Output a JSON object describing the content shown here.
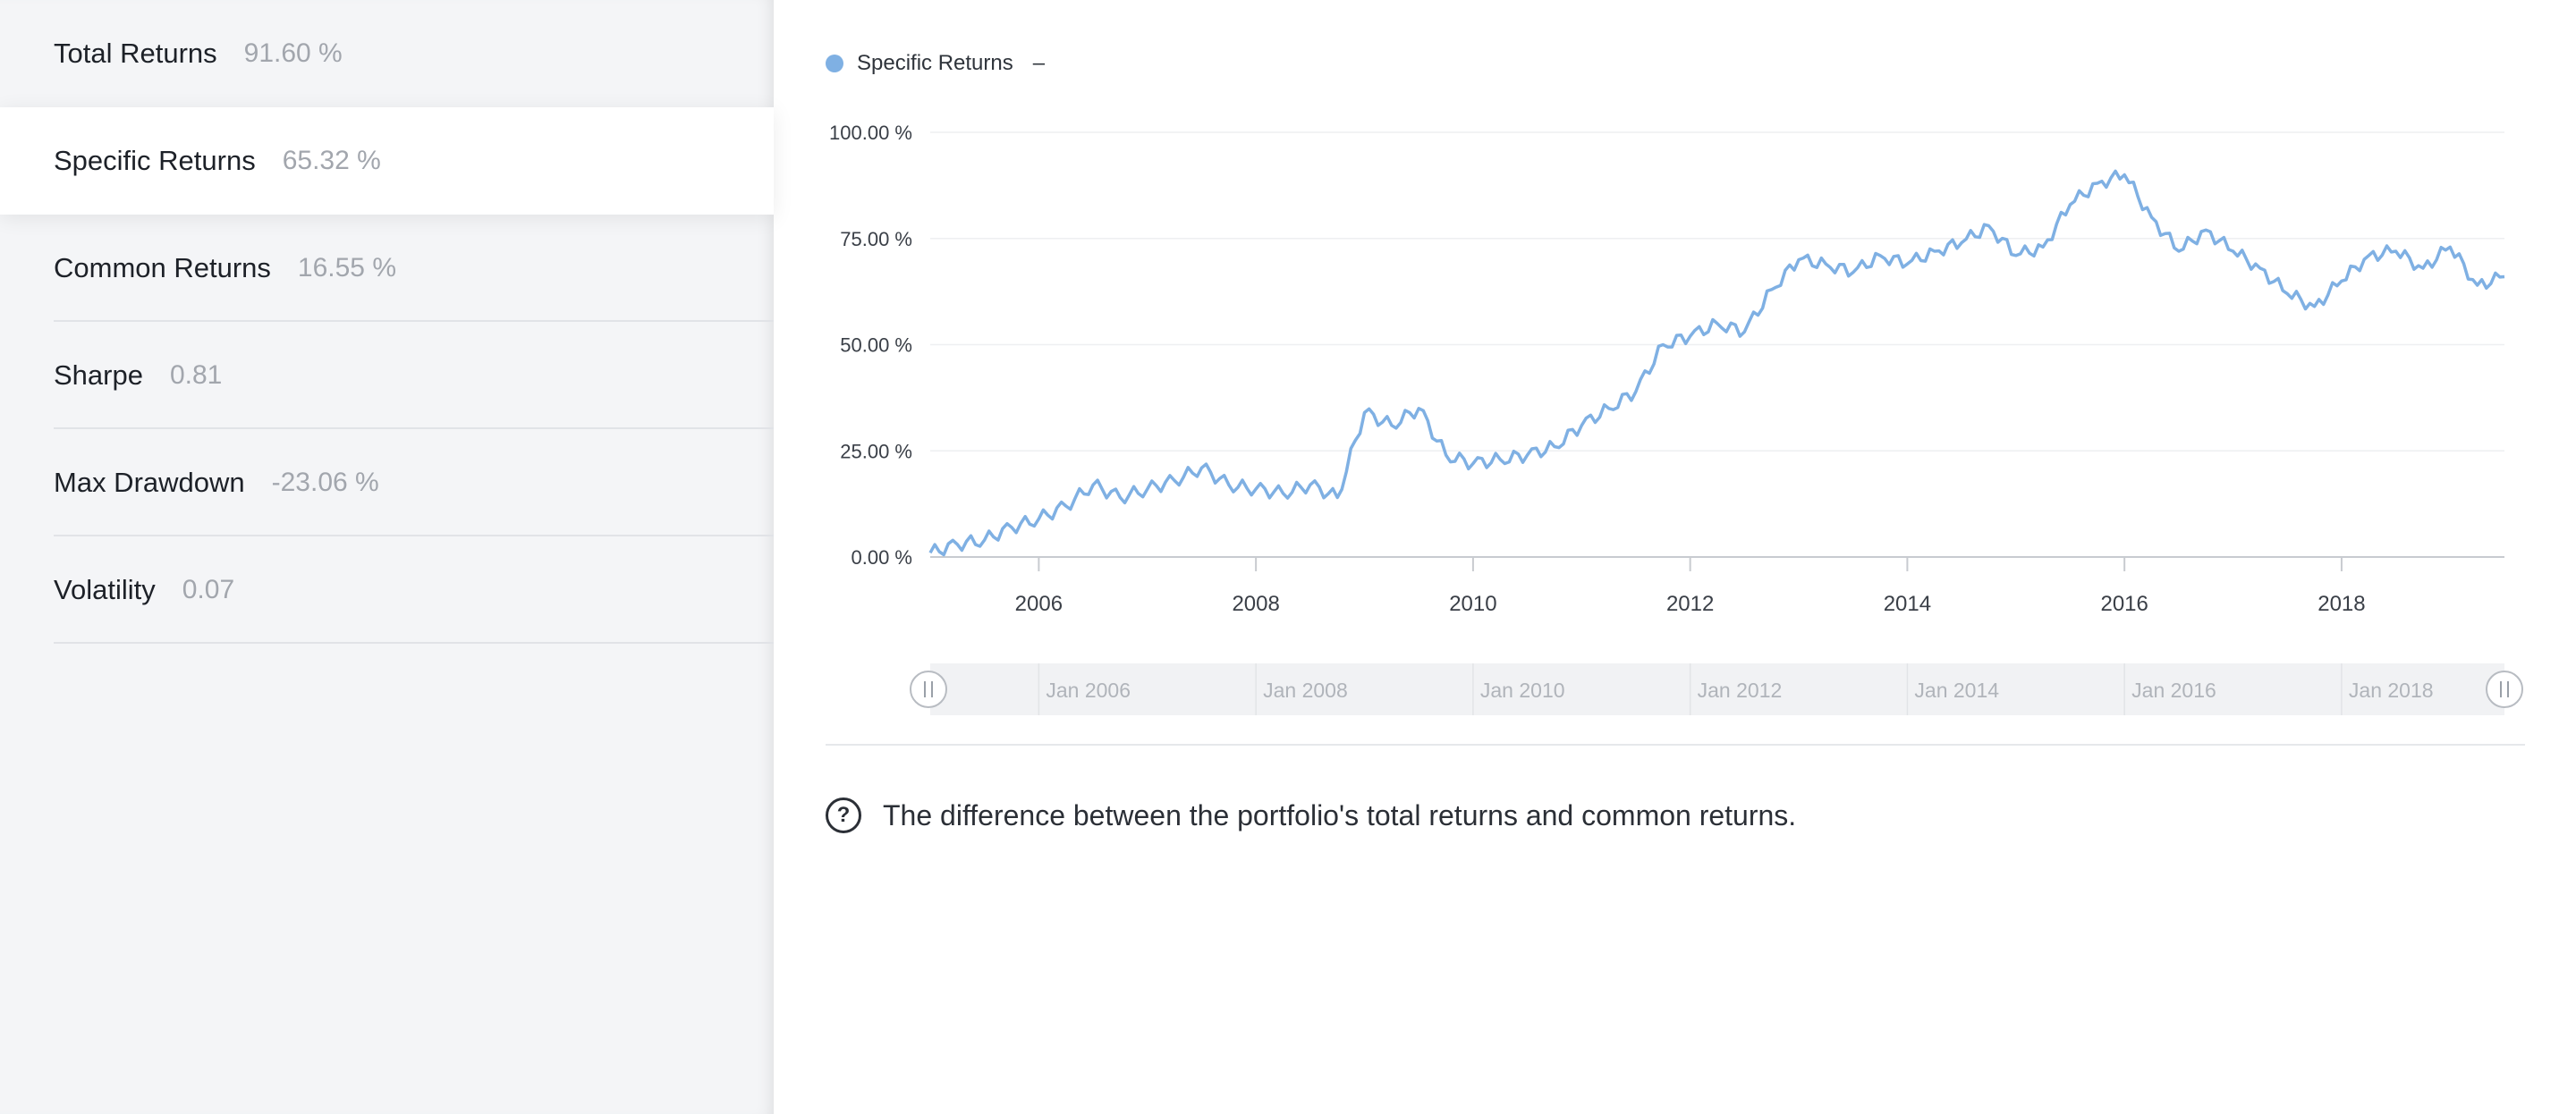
{
  "sidebar": {
    "metrics": [
      {
        "label": "Total Returns",
        "value": "91.60 %"
      },
      {
        "label": "Specific Returns",
        "value": "65.32 %"
      },
      {
        "label": "Common Returns",
        "value": "16.55 %"
      },
      {
        "label": "Sharpe",
        "value": "0.81"
      },
      {
        "label": "Max Drawdown",
        "value": "-23.06 %"
      },
      {
        "label": "Volatility",
        "value": "0.07"
      }
    ],
    "active_index": 1
  },
  "legend": {
    "series_name": "Specific Returns",
    "value": "–"
  },
  "info_text": "The difference between the portfolio's total returns and common returns.",
  "colors": {
    "series": "#7fb0e3",
    "grid": "#eeeff1",
    "axis": "#c8cbd0"
  },
  "chart_data": {
    "type": "line",
    "title": "",
    "xlabel": "",
    "ylabel": "",
    "ylim": [
      0,
      100
    ],
    "xlim": [
      "2005-01",
      "2019-07"
    ],
    "y_ticks": [
      "0.00 %",
      "25.00 %",
      "50.00 %",
      "75.00 %",
      "100.00 %"
    ],
    "x_ticks": [
      "2006",
      "2008",
      "2010",
      "2012",
      "2014",
      "2016",
      "2018"
    ],
    "navigator_ticks": [
      "Jan 2006",
      "Jan 2008",
      "Jan 2010",
      "Jan 2012",
      "Jan 2014",
      "Jan 2016",
      "Jan 2018"
    ],
    "grid": true,
    "series": [
      {
        "name": "Specific Returns",
        "x": [
          "2005-01",
          "2005-04",
          "2005-07",
          "2005-10",
          "2006-01",
          "2006-04",
          "2006-07",
          "2006-10",
          "2007-01",
          "2007-04",
          "2007-07",
          "2007-10",
          "2008-01",
          "2008-04",
          "2008-07",
          "2008-10",
          "2009-01",
          "2009-04",
          "2009-07",
          "2009-10",
          "2010-01",
          "2010-04",
          "2010-07",
          "2010-10",
          "2011-01",
          "2011-04",
          "2011-07",
          "2011-10",
          "2012-01",
          "2012-04",
          "2012-07",
          "2012-10",
          "2013-01",
          "2013-04",
          "2013-07",
          "2013-10",
          "2014-01",
          "2014-04",
          "2014-07",
          "2014-10",
          "2015-01",
          "2015-04",
          "2015-07",
          "2015-10",
          "2016-01",
          "2016-04",
          "2016-07",
          "2016-10",
          "2017-01",
          "2017-04",
          "2017-07",
          "2017-10",
          "2018-01",
          "2018-04",
          "2018-07",
          "2018-10",
          "2019-01",
          "2019-04",
          "2019-07"
        ],
        "values": [
          1,
          3,
          4,
          7,
          9,
          12,
          17,
          14,
          16,
          18,
          21,
          17,
          16,
          15,
          17,
          14,
          34,
          31,
          35,
          24,
          22,
          23,
          24,
          26,
          31,
          35,
          39,
          50,
          52,
          55,
          53,
          63,
          70,
          69,
          67,
          71,
          69,
          72,
          74,
          78,
          71,
          73,
          83,
          88,
          90,
          80,
          72,
          77,
          72,
          68,
          62,
          59,
          65,
          71,
          72,
          68,
          73,
          64,
          66
        ]
      }
    ]
  }
}
